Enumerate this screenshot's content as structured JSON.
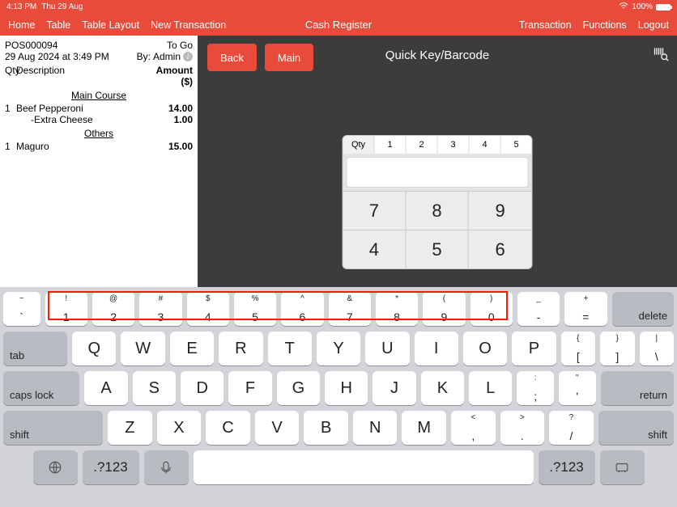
{
  "status": {
    "time": "4:13 PM",
    "date": "Thu 29 Aug",
    "battery": "100%"
  },
  "nav": {
    "left": [
      "Home",
      "Table",
      "Table Layout",
      "New Transaction"
    ],
    "title": "Cash Register",
    "right": [
      "Transaction",
      "Functions",
      "Logout"
    ]
  },
  "receipt": {
    "id": "POS000094",
    "mode": "To Go",
    "datetime": "29 Aug 2024 at 3:49 PM",
    "by_label": "By:",
    "by_value": "Admin",
    "qty_label": "Qty",
    "desc_label": "Description",
    "amount_label": "Amount ($)",
    "sections": [
      {
        "title": "Main Course",
        "lines": [
          {
            "qty": "1",
            "desc": "Beef Pepperoni",
            "amount": "14.00",
            "mods": [
              {
                "desc": "-Extra Cheese",
                "amount": "1.00"
              }
            ]
          }
        ]
      },
      {
        "title": "Others",
        "lines": [
          {
            "qty": "1",
            "desc": "Maguro",
            "amount": "15.00",
            "mods": []
          }
        ]
      }
    ]
  },
  "panel": {
    "back": "Back",
    "main": "Main",
    "title": "Quick Key/Barcode",
    "qty_label": "Qty",
    "qty_options": [
      "1",
      "2",
      "3",
      "4",
      "5"
    ],
    "numpad": [
      "7",
      "8",
      "9",
      "4",
      "5",
      "6"
    ]
  },
  "keyboard": {
    "row1": [
      {
        "sup": "~",
        "main": "`"
      },
      {
        "sup": "!",
        "main": "1"
      },
      {
        "sup": "@",
        "main": "2"
      },
      {
        "sup": "#",
        "main": "3"
      },
      {
        "sup": "$",
        "main": "4"
      },
      {
        "sup": "%",
        "main": "5"
      },
      {
        "sup": "^",
        "main": "6"
      },
      {
        "sup": "&",
        "main": "7"
      },
      {
        "sup": "*",
        "main": "8"
      },
      {
        "sup": "(",
        "main": "9"
      },
      {
        "sup": ")",
        "main": "0"
      },
      {
        "sup": "_",
        "main": "-"
      },
      {
        "sup": "+",
        "main": "="
      }
    ],
    "delete": "delete",
    "tab": "tab",
    "row2": [
      "Q",
      "W",
      "E",
      "R",
      "T",
      "Y",
      "U",
      "I",
      "O",
      "P"
    ],
    "row2_tail": [
      {
        "sup": "{",
        "main": "["
      },
      {
        "sup": "}",
        "main": "]"
      },
      {
        "sup": "|",
        "main": "\\"
      }
    ],
    "caps": "caps lock",
    "row3": [
      "A",
      "S",
      "D",
      "F",
      "G",
      "H",
      "J",
      "K",
      "L"
    ],
    "row3_tail": [
      {
        "sup": ":",
        "main": ";"
      },
      {
        "sup": "\"",
        "main": "'"
      }
    ],
    "return": "return",
    "shift": "shift",
    "row4": [
      "Z",
      "X",
      "C",
      "V",
      "B",
      "N",
      "M"
    ],
    "row4_tail": [
      {
        "sup": "<",
        "main": ","
      },
      {
        "sup": ">",
        "main": "."
      },
      {
        "sup": "?",
        "main": "/"
      }
    ],
    "symbols": ".?123"
  }
}
